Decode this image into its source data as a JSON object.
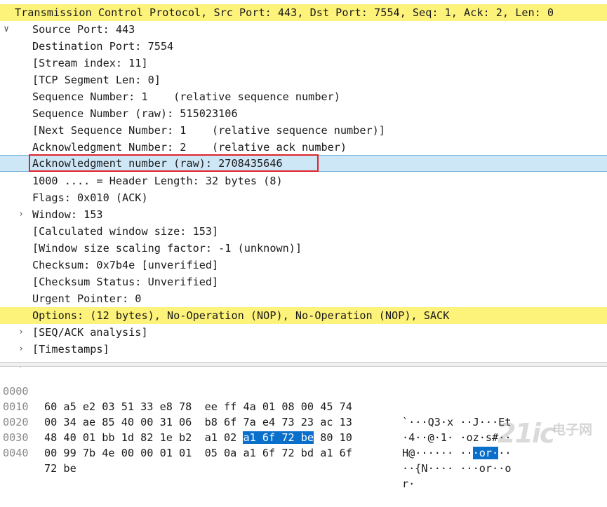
{
  "tree": {
    "header": "Transmission Control Protocol, Src Port: 443, Dst Port: 7554, Seq: 1, Ack: 2, Len: 0",
    "fields": [
      "Source Port: 443",
      "Destination Port: 7554",
      "[Stream index: 11]",
      "[TCP Segment Len: 0]",
      "Sequence Number: 1    (relative sequence number)",
      "Sequence Number (raw): 515023106",
      "[Next Sequence Number: 1    (relative sequence number)]",
      "Acknowledgment Number: 2    (relative ack number)",
      "Acknowledgment number (raw): 2708435646",
      "1000 .... = Header Length: 32 bytes (8)",
      "Flags: 0x010 (ACK)",
      "Window: 153",
      "[Calculated window size: 153]",
      "[Window size scaling factor: -1 (unknown)]",
      "Checksum: 0x7b4e [unverified]",
      "[Checksum Status: Unverified]",
      "Urgent Pointer: 0",
      "Options: (12 bytes), No-Operation (NOP), No-Operation (NOP), SACK",
      "[SEQ/ACK analysis]",
      "[Timestamps]"
    ]
  },
  "hex": {
    "rows": [
      {
        "offset": "0000",
        "b1": "60 a5 e2 03 51 33 e8 78",
        "b2": "ee ff 4a 01 08 00 45 74",
        "a1": "`···Q3·x",
        "a2": "··J···Et"
      },
      {
        "offset": "0010",
        "b1": "00 34 ae 85 40 00 31 06",
        "b2": "b8 6f 7a e4 73 23 ac 13",
        "a1": "·4··@·1·",
        "a2": "·oz·s#··"
      },
      {
        "offset": "0020",
        "b1": "48 40 01 bb 1d 82 1e b2",
        "b2_pre": "a1 02 ",
        "b2_hl": "a1 6f 72 be",
        "b2_post": " 80 10",
        "a1": "H@······",
        "a2_pre": "··",
        "a2_hl": "·or·",
        "a2_post": "··"
      },
      {
        "offset": "0030",
        "b1": "00 99 7b 4e 00 00 01 01",
        "b2": "05 0a a1 6f 72 bd a1 6f",
        "a1": "··{N····",
        "a2": "···or··o"
      },
      {
        "offset": "0040",
        "b1": "72 be",
        "b2": "",
        "a1": "r·",
        "a2": ""
      }
    ]
  },
  "watermark": {
    "logo": "21ic",
    "cn": "电子网"
  },
  "colors": {
    "highlight_yellow": "#fdf37b",
    "selection_blue": "#cde7f7",
    "byte_highlight": "#0a6fcb",
    "annotation_red": "#e0242a"
  }
}
